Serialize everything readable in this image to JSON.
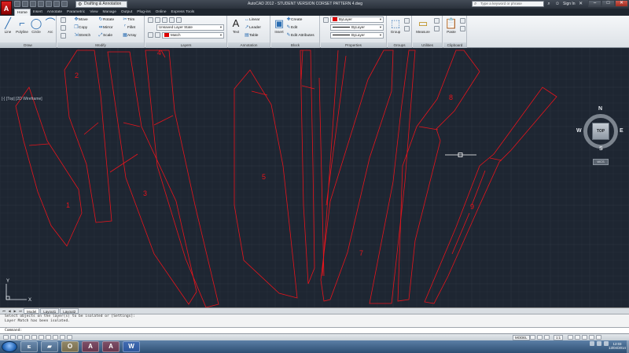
{
  "titlebar": {
    "app_logo": "A",
    "workspace": "Drafting & Annotation",
    "window_title": "AutoCAD 2012 - STUDENT VERSION   CORSET PATTERN 4.dwg",
    "search_placeholder": "Type a keyword or phrase",
    "sign_in": "Sign In"
  },
  "ribbon_tabs": [
    "Home",
    "Insert",
    "Annotate",
    "Parametric",
    "View",
    "Manage",
    "Output",
    "Plug-ins",
    "Online",
    "Express Tools"
  ],
  "ribbon": {
    "draw": {
      "title": "Draw",
      "tools": [
        "Line",
        "Polyline",
        "Circle",
        "Arc"
      ]
    },
    "modify": {
      "title": "Modify",
      "tools": [
        "Move",
        "Rotate",
        "Trim",
        "Copy",
        "Mirror",
        "Fillet",
        "Stretch",
        "Scale",
        "Array"
      ]
    },
    "layers": {
      "title": "Layers",
      "layer_state": "Unsaved Layer State",
      "current_layer": "Match"
    },
    "annotation": {
      "title": "Annotation",
      "text": "Text",
      "tools": [
        "Linear",
        "Leader",
        "Table"
      ]
    },
    "block": {
      "title": "Block",
      "insert": "Insert",
      "tools": [
        "Create",
        "Edit",
        "Edit Attributes"
      ]
    },
    "properties": {
      "title": "Properties",
      "color": "ByLayer",
      "linetype": "ByLayer",
      "lineweight": "ByLayer"
    },
    "groups": {
      "title": "Groups",
      "group": "Group"
    },
    "utilities": {
      "title": "Utilities",
      "measure": "Measure"
    },
    "clipboard": {
      "title": "Clipboard",
      "paste": "Paste"
    }
  },
  "viewport_label": "[-] [Top] [2D Wireframe]",
  "viewcube": {
    "face": "TOP",
    "north": "N",
    "south": "S",
    "east": "E",
    "west": "W",
    "wcs": "WCS"
  },
  "pattern_labels": [
    "1",
    "2",
    "3",
    "4",
    "5",
    "7",
    "8",
    "9"
  ],
  "layout_tabs": [
    "Model",
    "Layout1",
    "Layout2"
  ],
  "command_history": [
    "Select objects on the layer(s) to be isolated or [Settings]:",
    "Layer Match has been isolated."
  ],
  "command_prompt": "Command:",
  "statusbar": {
    "model": "MODEL",
    "scale": "1:1"
  },
  "taskbar": {
    "apps": [
      "IE",
      "Explorer",
      "Outlook",
      "AutoCAD",
      "AutoCAD",
      "Word"
    ],
    "time": "12:03",
    "date": "13/04/2014"
  },
  "colors": {
    "drawing_bg": "#1e2632",
    "pattern_line": "#e8141c",
    "grid_minor": "#262f3b",
    "grid_major": "#2e3845"
  }
}
